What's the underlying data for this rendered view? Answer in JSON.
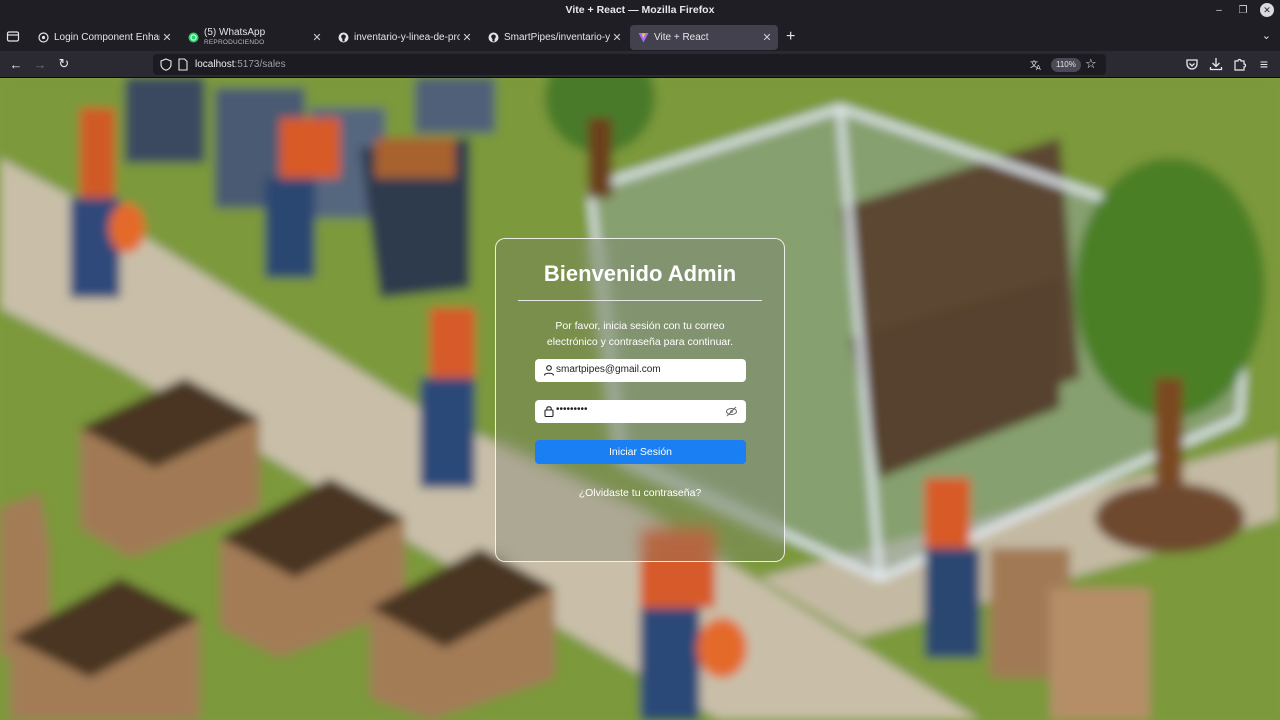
{
  "window": {
    "title": "Vite + React — Mozilla Firefox"
  },
  "tabs": [
    {
      "label": "Login Component Enhance",
      "sub": "",
      "icon": "chatgpt-icon",
      "active": false
    },
    {
      "label": "(5) WhatsApp",
      "sub": "REPRODUCIENDO",
      "icon": "whatsapp-icon",
      "active": false
    },
    {
      "label": "inventario-y-linea-de-produ",
      "sub": "",
      "icon": "github-icon",
      "active": false
    },
    {
      "label": "SmartPipes/inventario-y-lin",
      "sub": "",
      "icon": "github-icon",
      "active": false
    },
    {
      "label": "Vite + React",
      "sub": "",
      "icon": "vite-icon",
      "active": true
    }
  ],
  "nav": {
    "url_host": "localhost",
    "url_path": ":5173/sales",
    "zoom": "110%"
  },
  "login": {
    "title": "Bienvenido Admin",
    "intro_line1": "Por favor, inicia sesión con tu correo",
    "intro_line2": "electrónico y contraseña para continuar.",
    "email_value": "smartpipes@gmail.com",
    "password_value": "•••••••••",
    "submit_label": "Iniciar Sesión",
    "forgot_label": "¿Olvidaste tu contraseña?"
  },
  "colors": {
    "accent": "#1a7ff2",
    "grass": "#7e9b3c",
    "path": "#c9bfa9"
  }
}
